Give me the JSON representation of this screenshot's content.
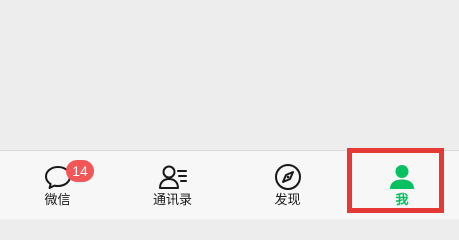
{
  "tabbar": {
    "tabs": [
      {
        "id": "chats",
        "label": "微信",
        "icon": "chat-bubble-icon",
        "badge": "14",
        "active": false
      },
      {
        "id": "contacts",
        "label": "通讯录",
        "icon": "contacts-icon",
        "active": false
      },
      {
        "id": "discover",
        "label": "发现",
        "icon": "compass-icon",
        "active": false
      },
      {
        "id": "me",
        "label": "我",
        "icon": "person-icon",
        "active": true
      }
    ]
  },
  "colors": {
    "active_tab": "#07c160",
    "badge": "#f25657",
    "highlight_box": "#e53935",
    "background": "#ededed",
    "tabbar_background": "#f7f7f7"
  }
}
